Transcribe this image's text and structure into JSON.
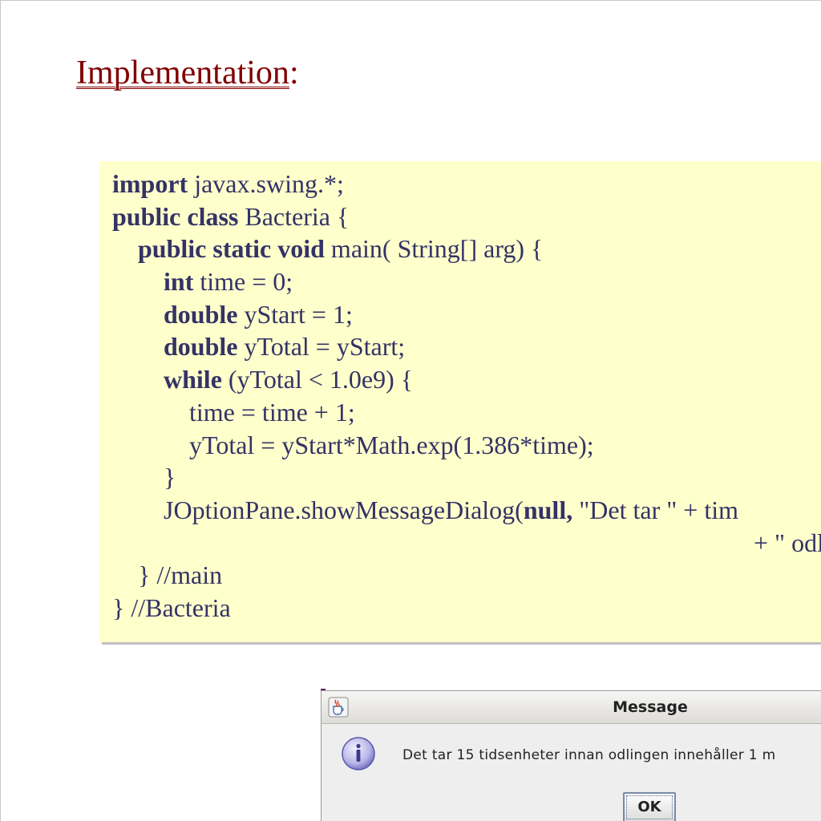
{
  "slide": {
    "title_main": "Implementation",
    "title_colon": ":"
  },
  "code": {
    "lines": [
      {
        "indent": "",
        "parts": [
          {
            "t": "import",
            "kw": true
          },
          {
            "t": " javax.swing.*;"
          }
        ]
      },
      {
        "indent": "",
        "parts": [
          {
            "t": "public",
            "kw": true
          },
          {
            "t": " "
          },
          {
            "t": "class",
            "kw": true
          },
          {
            "t": " Bacteria {"
          }
        ]
      },
      {
        "indent": "    ",
        "parts": [
          {
            "t": "public",
            "kw": true
          },
          {
            "t": " "
          },
          {
            "t": "static",
            "kw": true
          },
          {
            "t": " "
          },
          {
            "t": "void",
            "kw": true
          },
          {
            "t": " main( String[] arg) {"
          }
        ]
      },
      {
        "indent": "        ",
        "parts": [
          {
            "t": "int",
            "kw": true
          },
          {
            "t": " time = 0;"
          }
        ]
      },
      {
        "indent": "        ",
        "parts": [
          {
            "t": "double",
            "kw": true
          },
          {
            "t": " yStart = 1;"
          }
        ]
      },
      {
        "indent": "        ",
        "parts": [
          {
            "t": "double",
            "kw": true
          },
          {
            "t": " yTotal = yStart;"
          }
        ]
      },
      {
        "indent": "        ",
        "parts": [
          {
            "t": "while",
            "kw": true
          },
          {
            "t": " (yTotal < 1.0e9) {"
          }
        ]
      },
      {
        "indent": "            ",
        "parts": [
          {
            "t": "time = time + 1;"
          }
        ]
      },
      {
        "indent": "            ",
        "parts": [
          {
            "t": "yTotal = yStart*Math.exp(1.386*time);"
          }
        ]
      },
      {
        "indent": "        ",
        "parts": [
          {
            "t": "}"
          }
        ]
      },
      {
        "indent": "        ",
        "parts": [
          {
            "t": "JOptionPane.showMessageDialog("
          },
          {
            "t": "null,",
            "kw": true
          },
          {
            "t": " \"Det tar \" + tim"
          }
        ]
      },
      {
        "indent": "                                                                                                    ",
        "parts": [
          {
            "t": "+ \" odlingen innehåll"
          }
        ]
      },
      {
        "indent": "    ",
        "parts": [
          {
            "t": "} //main"
          }
        ]
      },
      {
        "indent": "",
        "parts": [
          {
            "t": "} //Bacteria"
          }
        ]
      }
    ]
  },
  "dialog": {
    "title": "Message",
    "message": "Det tar 15 tidsenheter innan odlingen innehåller 1 m",
    "ok_label": "OK",
    "window_icon": "java-coffee-cup-icon",
    "message_icon": "information-icon"
  },
  "colors": {
    "title": "#800000",
    "code_text": "#333366",
    "code_background": "#ffffcc"
  }
}
